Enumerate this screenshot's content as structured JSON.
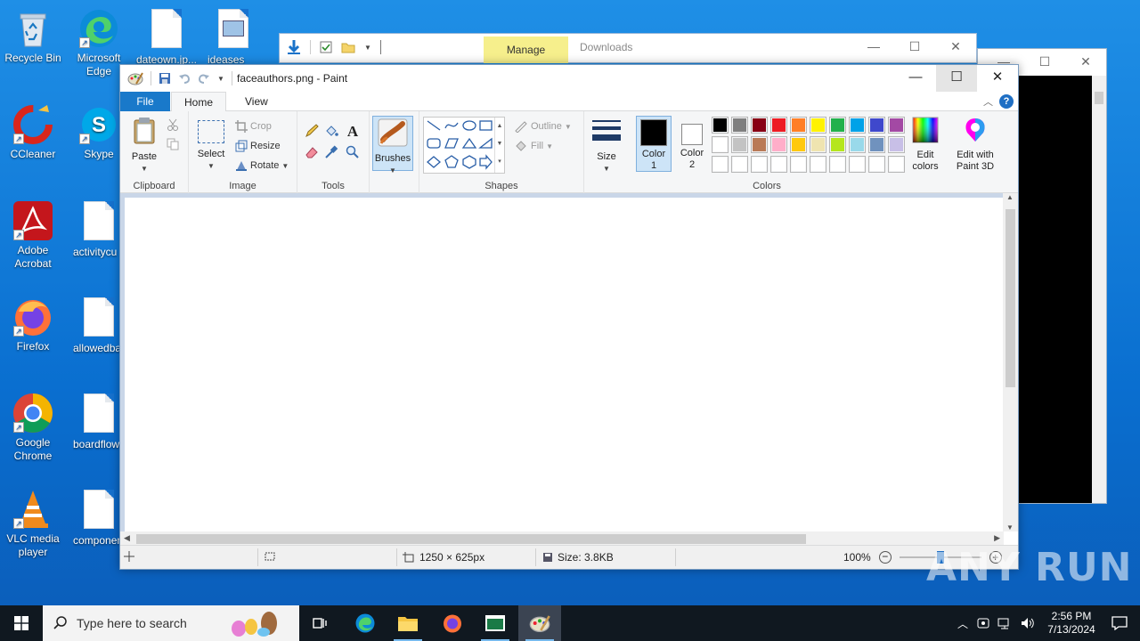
{
  "desktop": {
    "icons": [
      {
        "name": "recycle-bin",
        "label": "Recycle Bin"
      },
      {
        "name": "microsoft-edge",
        "label": "Microsoft Edge"
      },
      {
        "name": "ccleaner",
        "label": "CCleaner"
      },
      {
        "name": "skype",
        "label": "Skype"
      },
      {
        "name": "adobe-acrobat",
        "label": "Adobe Acrobat"
      },
      {
        "name": "firefox",
        "label": "Firefox"
      },
      {
        "name": "google-chrome",
        "label": "Google Chrome"
      },
      {
        "name": "vlc",
        "label": "VLC media player"
      }
    ],
    "files": [
      {
        "label": "dateown.jp..."
      },
      {
        "label": "ideases"
      },
      {
        "label": "activitycu"
      },
      {
        "label": "allowedba"
      },
      {
        "label": "boardflowe"
      },
      {
        "label": "componen"
      }
    ]
  },
  "explorer": {
    "manage_tab": "Manage",
    "title": "Downloads"
  },
  "paint": {
    "title": "faceauthors.png - Paint",
    "tabs": {
      "file": "File",
      "home": "Home",
      "view": "View"
    },
    "clipboard": {
      "paste": "Paste",
      "group": "Clipboard"
    },
    "image": {
      "select": "Select",
      "crop": "Crop",
      "resize": "Resize",
      "rotate": "Rotate",
      "group": "Image"
    },
    "tools": {
      "group": "Tools"
    },
    "brushes": {
      "label": "Brushes"
    },
    "shapes": {
      "outline": "Outline",
      "fill": "Fill",
      "group": "Shapes"
    },
    "size": {
      "label": "Size"
    },
    "color1": {
      "label": "Color 1",
      "value": "#000000"
    },
    "color2": {
      "label": "Color 2",
      "value": "#ffffff"
    },
    "colors": {
      "group": "Colors",
      "edit_colors": "Edit colors",
      "edit_paint3d": "Edit with Paint 3D",
      "palette_row1": [
        "#000000",
        "#7f7f7f",
        "#880015",
        "#ed1c24",
        "#ff7f27",
        "#fff200",
        "#22b14c",
        "#00a2e8",
        "#3f48cc",
        "#a349a4"
      ],
      "palette_row2": [
        "#ffffff",
        "#c3c3c3",
        "#b97a57",
        "#ffaec9",
        "#ffc90e",
        "#efe4b0",
        "#b5e61d",
        "#99d9ea",
        "#7092be",
        "#c8bfe7"
      ],
      "palette_row3": [
        "#ffffff",
        "#ffffff",
        "#ffffff",
        "#ffffff",
        "#ffffff",
        "#ffffff",
        "#ffffff",
        "#ffffff",
        "#ffffff",
        "#ffffff"
      ]
    },
    "status": {
      "dimensions": "1250 × 625px",
      "size": "Size: 3.8KB",
      "zoom": "100%"
    }
  },
  "taskbar": {
    "search_placeholder": "Type here to search",
    "time": "2:56 PM",
    "date": "7/13/2024"
  },
  "watermark": "ANY RUN"
}
